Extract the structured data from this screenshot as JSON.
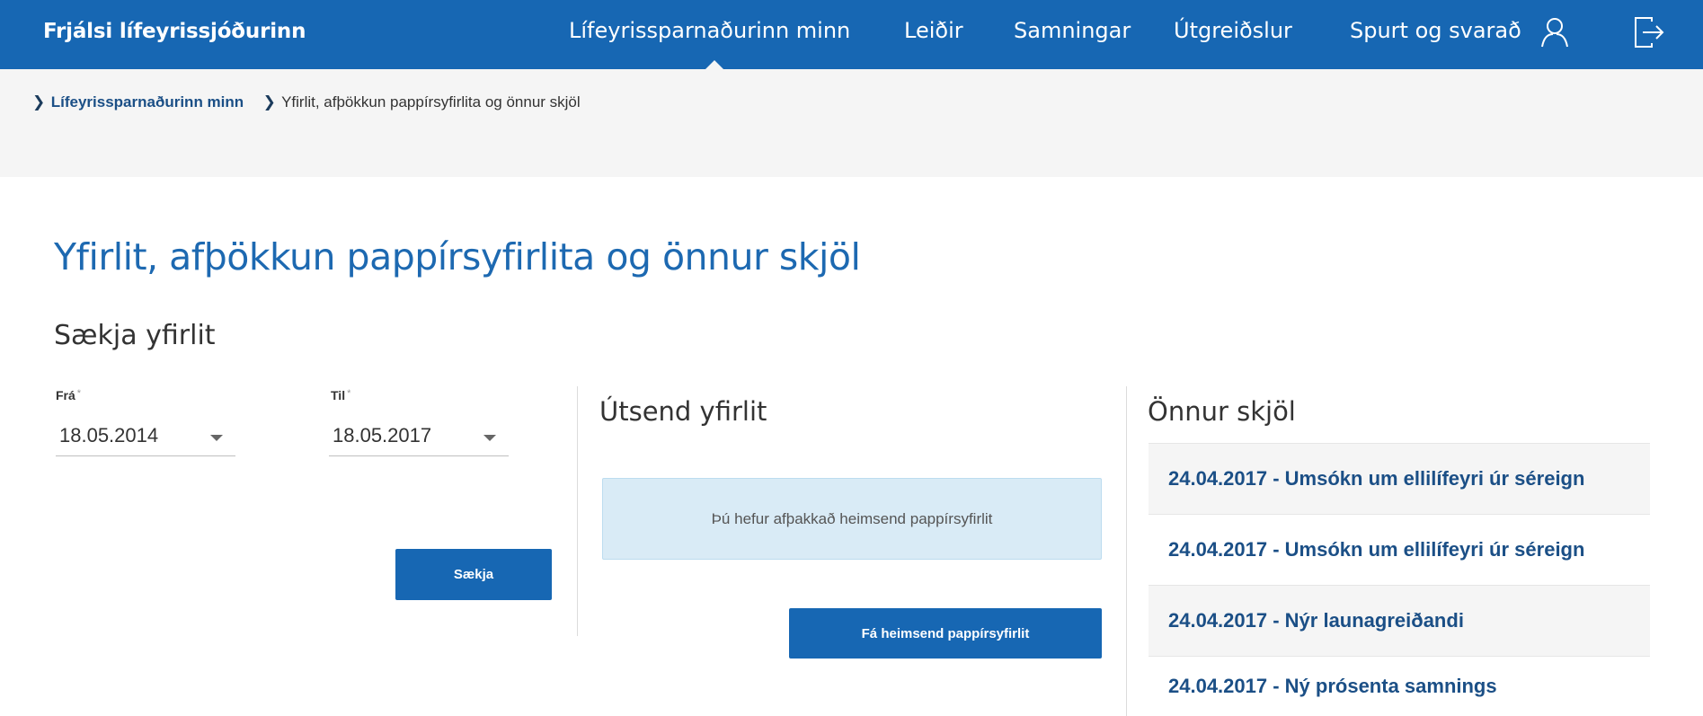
{
  "header": {
    "brand": "Frjálsi lífeyrissjóðurinn",
    "nav": [
      {
        "label": "Lífeyrissparnaðurinn minn"
      },
      {
        "label": "Leiðir"
      },
      {
        "label": "Samningar"
      },
      {
        "label": "Útgreiðslur"
      },
      {
        "label": "Spurt og svarað"
      }
    ],
    "icons": {
      "user": "user-icon",
      "logout": "logout-icon"
    }
  },
  "breadcrumb": {
    "link": "Lífeyrissparnaðurinn minn",
    "current": "Yfirlit, afþökkun pappírsyfirlita og önnur skjöl"
  },
  "page": {
    "title": "Yfirlit, afþökkun pappírsyfirlita og önnur skjöl"
  },
  "fetch": {
    "title": "Sækja yfirlit",
    "from_label": "Frá",
    "from_value": "18.05.2014",
    "to_label": "Til",
    "to_value": "18.05.2017",
    "required_mark": "*",
    "button": "Sækja"
  },
  "sent": {
    "title": "Útsend yfirlit",
    "notice": "Þú hefur afþakkað heimsend pappírsyfirlit",
    "button": "Fá heimsend pappírsyfirlit"
  },
  "other_docs": {
    "title": "Önnur skjöl",
    "items": [
      {
        "label": "24.04.2017 - Umsókn um ellilífeyri úr séreign"
      },
      {
        "label": "24.04.2017 - Umsókn um ellilífeyri úr séreign"
      },
      {
        "label": "24.04.2017 - Nýr launagreiðandi"
      },
      {
        "label": "24.04.2017 - Ný prósenta samnings"
      }
    ]
  },
  "colors": {
    "primary": "#1767b3",
    "link": "#1b4f86",
    "notice_bg": "#d9ebf6",
    "band_bg": "#f5f5f5"
  }
}
